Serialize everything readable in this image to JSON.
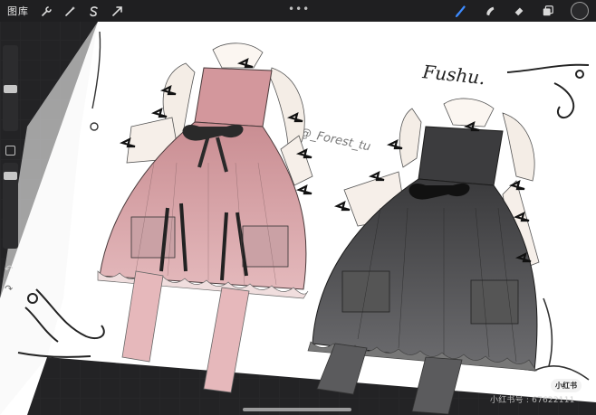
{
  "toolbar": {
    "gallery_label": "图库",
    "center_dots": "•••",
    "tools_left": [
      "wrench-icon",
      "magic-wand-icon",
      "selection-s-icon",
      "transform-arrow-icon"
    ],
    "tools_right": [
      "brush-icon",
      "smudge-icon",
      "eraser-icon",
      "layers-icon",
      "color-picker"
    ],
    "active_tool_color": "#3d8bff"
  },
  "canvas": {
    "signature": "Fushu.",
    "watermark_artist": "@_Forest_tu",
    "paper_color": "#ffffff",
    "pink_dress_color": "#d8a3a7",
    "black_dress_color": "#4a4a4c"
  },
  "overlay": {
    "badge": "小红书",
    "id_text": "小红书号 : 67622111"
  }
}
